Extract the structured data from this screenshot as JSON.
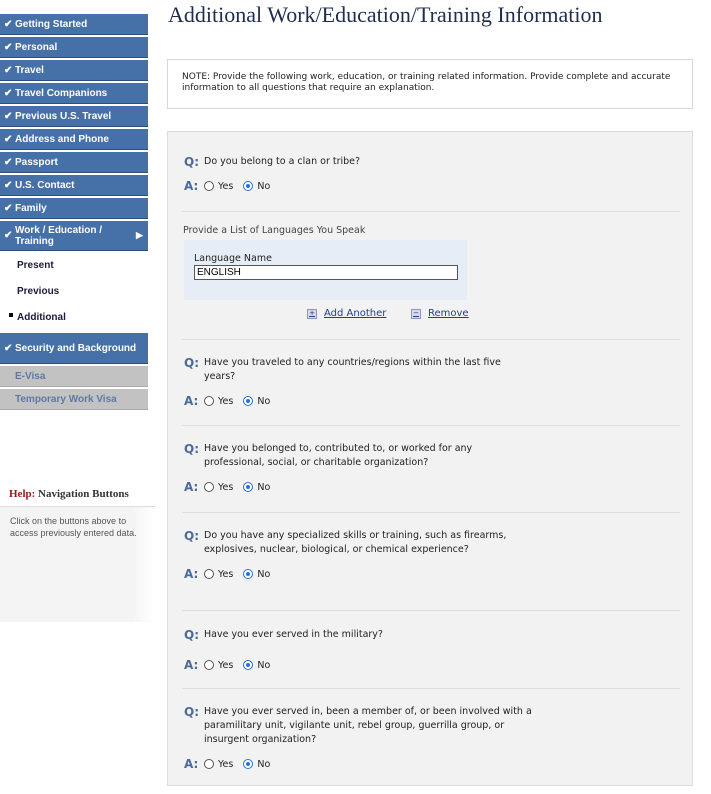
{
  "sidebar": {
    "items": [
      {
        "label": "Getting Started",
        "check": "✔"
      },
      {
        "label": "Personal",
        "check": "✔"
      },
      {
        "label": "Travel",
        "check": "✔"
      },
      {
        "label": "Travel Companions",
        "check": "✔"
      },
      {
        "label": "Previous U.S. Travel",
        "check": "✔"
      },
      {
        "label": "Address and Phone",
        "check": "✔"
      },
      {
        "label": "Passport",
        "check": "✔"
      },
      {
        "label": "U.S. Contact",
        "check": "✔"
      },
      {
        "label": "Family",
        "check": "✔"
      },
      {
        "label": "Work / Education / Training",
        "check": "✔",
        "arrow": "▶"
      }
    ],
    "subitems": [
      "Present",
      "Previous",
      "Additional"
    ],
    "after": [
      {
        "label": "Security and Background",
        "check": "✔"
      }
    ],
    "disabled": [
      "E-Visa",
      "Temporary Work Visa"
    ]
  },
  "help": {
    "title_prefix": "Help:",
    "title_rest": "Navigation Buttons",
    "body": "Click on the buttons above to access previously entered data."
  },
  "page": {
    "title": "Additional Work/Education/Training Information",
    "note": "NOTE: Provide the following work, education, or training related information. Provide complete and accurate information to all questions that require an explanation."
  },
  "form": {
    "q_marker": "Q:",
    "a_marker": "A:",
    "yes": "Yes",
    "no": "No",
    "questions": [
      {
        "text": "Do you belong to a clan or tribe?",
        "answer": "No"
      },
      {
        "text": "Have you traveled to any countries/regions within the last five years?",
        "answer": "No"
      },
      {
        "text": "Have you belonged to, contributed to, or worked for any professional, social, or charitable organization?",
        "answer": "No"
      },
      {
        "text": "Do you have any specialized skills or training, such as firearms, explosives, nuclear, biological, or chemical experience?",
        "answer": "No"
      },
      {
        "text": "Have you ever served in the military?",
        "answer": "No"
      },
      {
        "text": "Have you ever served in, been a member of, or been involved with a paramilitary unit, vigilante unit, rebel group, guerrilla group, or insurgent organization?",
        "answer": "No"
      }
    ],
    "languages": {
      "caption": "Provide a List of Languages You Speak",
      "field_label": "Language Name",
      "value": "ENGLISH",
      "add_label": "Add Another",
      "remove_label": "Remove"
    }
  },
  "colors": {
    "nav": "#4670a8",
    "accent": "#2a6fd6",
    "title": "#1f2d4e"
  }
}
